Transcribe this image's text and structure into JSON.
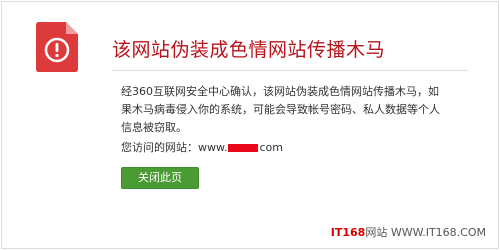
{
  "warning": {
    "title": "该网站伪装成色情网站传播木马",
    "message": "经360互联网安全中心确认，该网站伪装成色情网站传播木马，如果木马病毒侵入你的系统，可能会导致帐号密码、私人数据等个人信息被窃取。",
    "visited_prefix": "您访问的网站：",
    "url_start": "www.",
    "url_end": "com",
    "close_button": "关闭此页"
  },
  "icons": {
    "alert": "document-exclamation-icon"
  },
  "colors": {
    "title": "#b8141d",
    "icon": "#dd3a3c",
    "redaction": "#e8091b",
    "button": "#4a9b33"
  },
  "watermark": {
    "brand": "IT168",
    "text": "网站 WWW.IT168.COM"
  }
}
